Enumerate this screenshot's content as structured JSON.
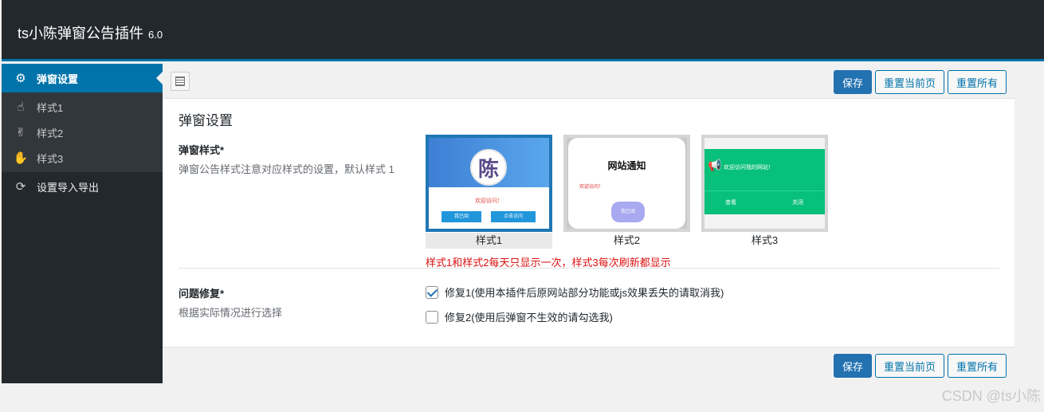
{
  "header": {
    "title": "ts小陈弹窗公告插件",
    "version": "6.0"
  },
  "sidebar": {
    "items": [
      {
        "label": "弹窗设置",
        "icon": "gear-icon"
      },
      {
        "label": "样式1",
        "icon": "hand-point-icon"
      },
      {
        "label": "样式2",
        "icon": "hand-peace-icon"
      },
      {
        "label": "样式3",
        "icon": "hand-open-icon"
      },
      {
        "label": "设置导入导出",
        "icon": "refresh-icon"
      }
    ]
  },
  "toolbar": {
    "save_label": "保存",
    "reset_page_label": "重置当前页",
    "reset_all_label": "重置所有"
  },
  "section": {
    "title": "弹窗设置"
  },
  "style_field": {
    "label": "弹窗样式*",
    "desc": "弹窗公告样式注意对应样式的设置，默认样式 1",
    "options": [
      {
        "caption": "样式1",
        "selected": true,
        "thumb": {
          "avatar": "陈",
          "text": "欢迎访问！",
          "btn1": "我已阅",
          "btn2": "点击访问"
        }
      },
      {
        "caption": "样式2",
        "selected": false,
        "thumb": {
          "title": "网站通知",
          "text": "欢迎访问！",
          "btn": "我已阅"
        }
      },
      {
        "caption": "样式3",
        "selected": false,
        "thumb": {
          "text": "欢迎访问我的网站！",
          "left": "查看",
          "right": "关闭"
        }
      }
    ],
    "note": "样式1和样式2每天只显示一次，样式3每次刷新都显示"
  },
  "fix_field": {
    "label": "问题修复*",
    "desc": "根据实际情况进行选择",
    "options": [
      {
        "label": "修复1(使用本插件后原网站部分功能或js效果丢失的请取消我)",
        "checked": true
      },
      {
        "label": "修复2(使用后弹窗不生效的请勾选我)",
        "checked": false
      }
    ]
  },
  "watermark": "CSDN @ts小陈",
  "colors": {
    "accent": "#0073aa",
    "primary_button": "#2271b1",
    "warning": "#dc1111",
    "topbar": "#23282d"
  }
}
